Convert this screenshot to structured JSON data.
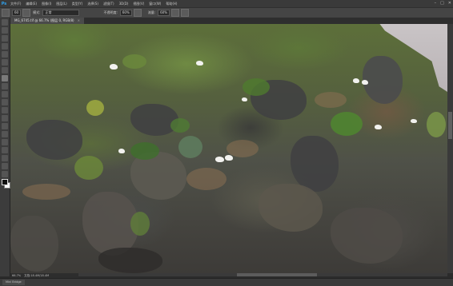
{
  "app": {
    "logo": "Ps"
  },
  "menubar": {
    "items": [
      "文件(F)",
      "编辑(E)",
      "图像(I)",
      "图层(L)",
      "类型(Y)",
      "选择(S)",
      "滤镜(T)",
      "3D(D)",
      "视图(V)",
      "窗口(W)",
      "帮助(H)"
    ],
    "window_controls": [
      "–",
      "□",
      "✕"
    ]
  },
  "options": {
    "tool_icon": "brush-icon",
    "size_value": "60",
    "mode_label": "模式:",
    "mode_value": "正常",
    "opacity_label": "不透明度:",
    "opacity_value": "60%",
    "flow_label": "流量:",
    "flow_value": "60%"
  },
  "document": {
    "tab_title": "MG_6745.tif @ 66.7% (图层 0, RGB/8)",
    "close": "×"
  },
  "status": {
    "zoom": "66.7%",
    "doc_info": "文档:18.4M/18.4M"
  },
  "bottom_panel": {
    "tab": "Mini Bridge"
  },
  "colors": {
    "foreground": "#111111",
    "background": "#ffffff",
    "accent": "#2fa3f0"
  }
}
